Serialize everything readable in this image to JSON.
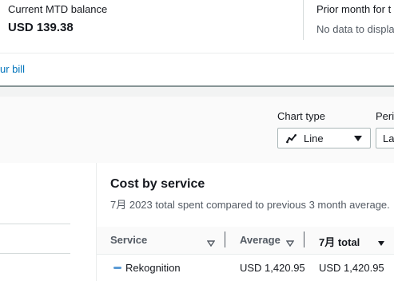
{
  "summary": {
    "current": {
      "label": "Current MTD balance",
      "value": "USD 139.38"
    },
    "prior": {
      "label": "Prior month for t",
      "value": "No data to displa"
    }
  },
  "bill_link": "ur bill",
  "controls": {
    "chart_type": {
      "label": "Chart type",
      "value": "Line",
      "icon": "line-chart-icon"
    },
    "period": {
      "label": "Peri",
      "value": "La"
    }
  },
  "cost_by_service": {
    "title": "Cost by service",
    "subtitle": "7月 2023 total spent compared to previous 3 month average.",
    "columns": [
      "Service",
      "Average",
      "7月 total"
    ],
    "rows": [
      {
        "service": "Rekognition",
        "average": "USD 1,420.95",
        "total": "USD 1,420.95",
        "color": "#5b9bd5"
      }
    ]
  },
  "colors": {
    "accent_link": "#0073bb",
    "series_rekognition": "#5b9bd5"
  }
}
